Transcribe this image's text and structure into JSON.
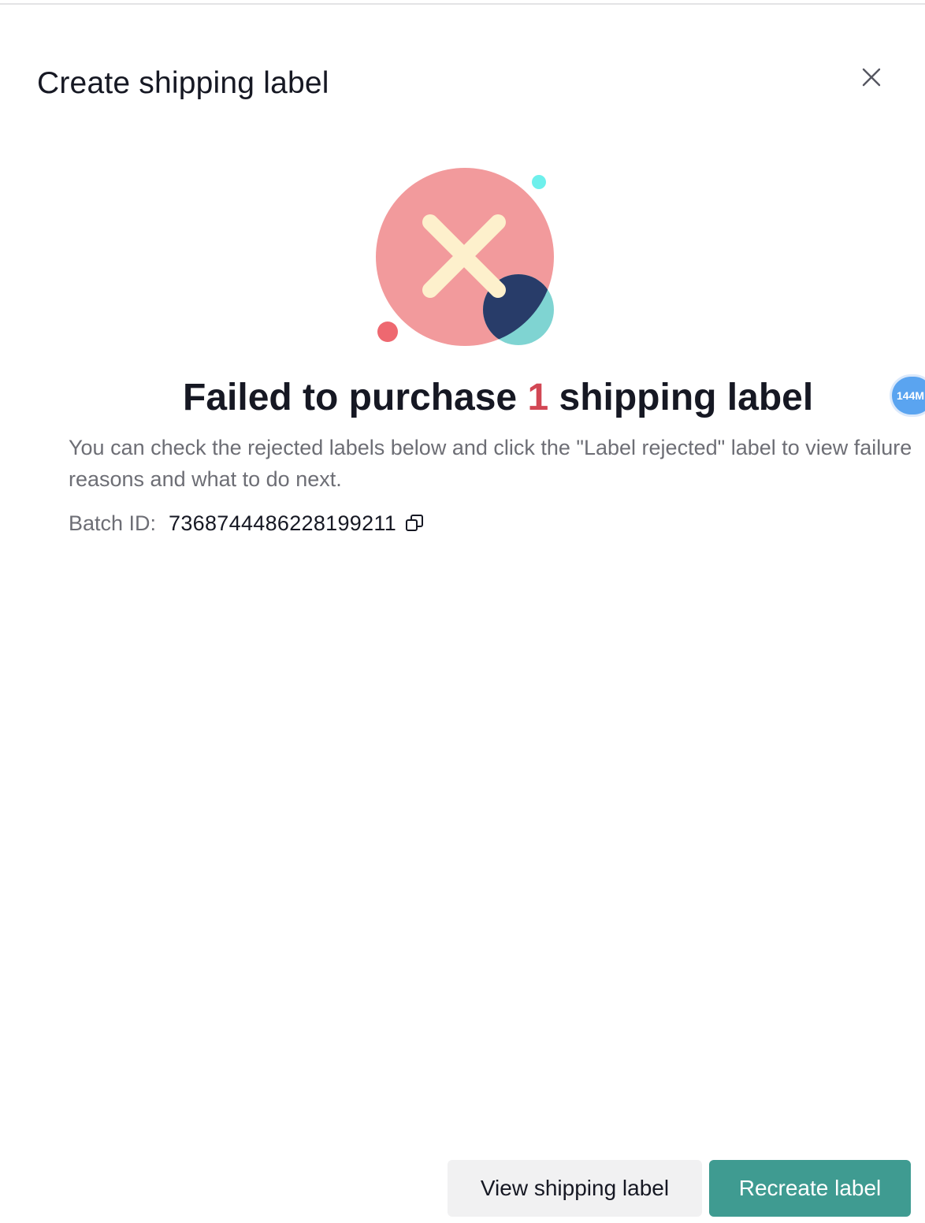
{
  "modal": {
    "title": "Create shipping label"
  },
  "result": {
    "headline_prefix": "Failed to purchase",
    "count": "1",
    "headline_suffix": "shipping label",
    "description": "You can check the rejected labels below and click the \"Label rejected\" label to view failure reasons and what to do next.",
    "batch_label": "Batch ID:",
    "batch_id": "7368744486228199211"
  },
  "floating_badge": {
    "text": "144M"
  },
  "actions": {
    "view_label": "View shipping label",
    "recreate_label": "Recreate label"
  },
  "icons": {
    "close": "close-icon",
    "copy": "copy-icon",
    "illustration": "error-x-illustration"
  },
  "colors": {
    "primary": "#3f9b91",
    "error_count": "#d24754",
    "illustration_circle": "#f29a9c",
    "illustration_x": "#fdf0cc",
    "illustration_navy": "#283c69",
    "illustration_teal": "#7fd4d2",
    "badge": "#5aa4f0"
  }
}
